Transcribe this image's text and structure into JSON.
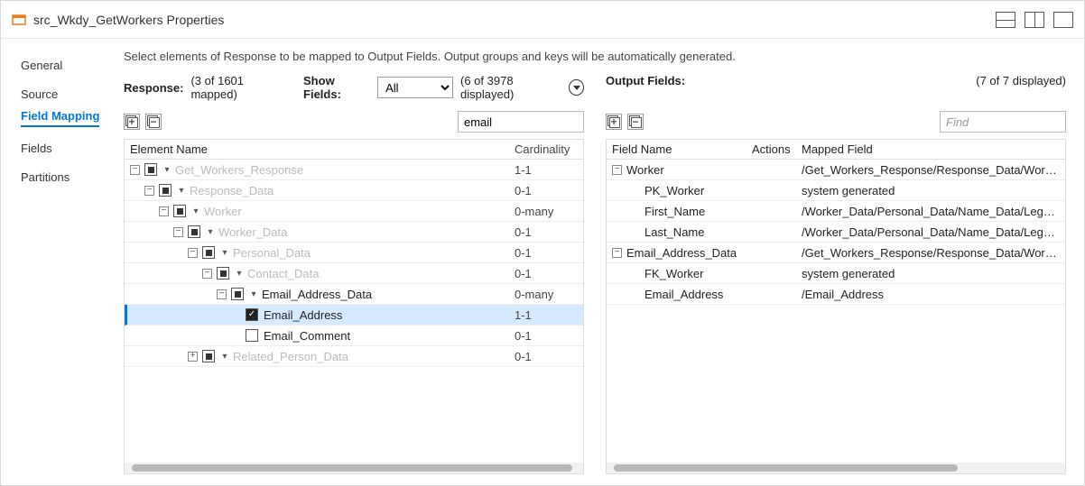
{
  "title": "src_Wkdy_GetWorkers Properties",
  "layout_icons": [
    "layout-stack",
    "layout-split-h",
    "layout-full"
  ],
  "sidebar": {
    "items": [
      {
        "label": "General"
      },
      {
        "label": "Source"
      },
      {
        "label": "Field Mapping",
        "active": true
      },
      {
        "label": "Fields"
      },
      {
        "label": "Partitions"
      }
    ]
  },
  "instruction": "Select elements of Response to be mapped to Output Fields. Output groups and keys will be automatically generated.",
  "response_bar": {
    "label": "Response:",
    "mapped_count": "(3 of 1601 mapped)",
    "show_fields_label": "Show Fields:",
    "show_fields_value": "All",
    "displayed_count": "(6 of 3978 displayed)"
  },
  "output_bar": {
    "label": "Output Fields:",
    "displayed_count": "(7 of 7 displayed)"
  },
  "left_search_value": "email",
  "right_search_placeholder": "Find",
  "left_headers": {
    "name": "Element Name",
    "card": "Cardinality"
  },
  "right_headers": {
    "field": "Field Name",
    "actions": "Actions",
    "mapped": "Mapped Field"
  },
  "elements": [
    {
      "indent": 0,
      "toggle": "−",
      "check": "partial",
      "chev": true,
      "name": "Get_Workers_Response",
      "card": "1-1",
      "dim": true
    },
    {
      "indent": 1,
      "toggle": "−",
      "check": "partial",
      "chev": true,
      "name": "Response_Data",
      "card": "0-1",
      "dim": true
    },
    {
      "indent": 2,
      "toggle": "−",
      "check": "partial",
      "chev": true,
      "name": "Worker",
      "card": "0-many",
      "dim": true
    },
    {
      "indent": 3,
      "toggle": "−",
      "check": "partial",
      "chev": true,
      "name": "Worker_Data",
      "card": "0-1",
      "dim": true
    },
    {
      "indent": 4,
      "toggle": "−",
      "check": "partial",
      "chev": true,
      "name": "Personal_Data",
      "card": "0-1",
      "dim": true
    },
    {
      "indent": 5,
      "toggle": "−",
      "check": "partial",
      "chev": true,
      "name": "Contact_Data",
      "card": "0-1",
      "dim": true
    },
    {
      "indent": 6,
      "toggle": "−",
      "check": "partial",
      "chev": true,
      "name": "Email_Address_Data",
      "card": "0-many",
      "dim": false
    },
    {
      "indent": 7,
      "toggle": "",
      "check": "checked",
      "chev": false,
      "name": "Email_Address",
      "card": "1-1",
      "dim": false,
      "selected": true
    },
    {
      "indent": 7,
      "toggle": "",
      "check": "empty",
      "chev": false,
      "name": "Email_Comment",
      "card": "0-1",
      "dim": false
    },
    {
      "indent": 4,
      "toggle": "+",
      "check": "partial",
      "chev": true,
      "name": "Related_Person_Data",
      "card": "0-1",
      "dim": true
    }
  ],
  "output_rows": [
    {
      "indent": 0,
      "toggle": "−",
      "name": "Worker",
      "mapped": "/Get_Workers_Response/Response_Data/Worker"
    },
    {
      "indent": 1,
      "toggle": "",
      "name": "PK_Worker",
      "mapped": "system generated"
    },
    {
      "indent": 1,
      "toggle": "",
      "name": "First_Name",
      "mapped": "/Worker_Data/Personal_Data/Name_Data/Legal_Name_D"
    },
    {
      "indent": 1,
      "toggle": "",
      "name": "Last_Name",
      "mapped": "/Worker_Data/Personal_Data/Name_Data/Legal_Name_D"
    },
    {
      "indent": 0,
      "toggle": "−",
      "name": "Email_Address_Data",
      "mapped": "/Get_Workers_Response/Response_Data/Worker/Worker_"
    },
    {
      "indent": 1,
      "toggle": "",
      "name": "FK_Worker",
      "mapped": "system generated"
    },
    {
      "indent": 1,
      "toggle": "",
      "name": "Email_Address",
      "mapped": "/Email_Address"
    }
  ]
}
